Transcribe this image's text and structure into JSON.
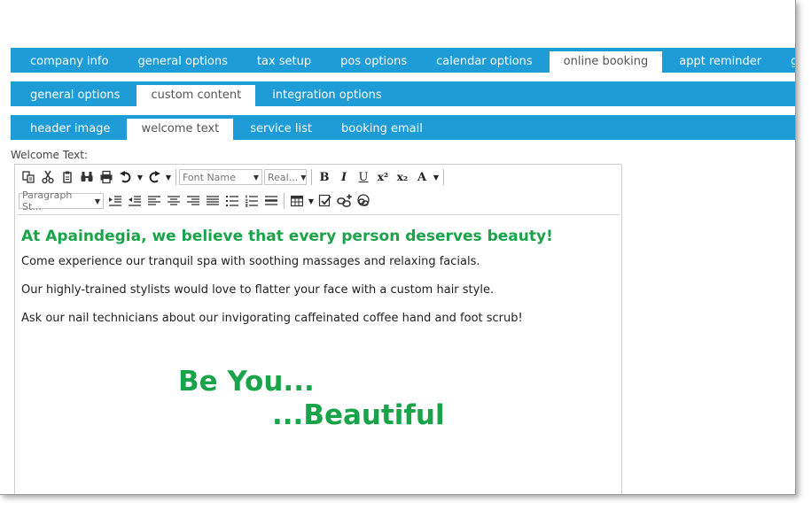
{
  "tabs_main": [
    {
      "label": "company info",
      "active": false
    },
    {
      "label": "general options",
      "active": false
    },
    {
      "label": "tax setup",
      "active": false
    },
    {
      "label": "pos options",
      "active": false
    },
    {
      "label": "calendar options",
      "active": false
    },
    {
      "label": "online booking",
      "active": true
    },
    {
      "label": "appt reminder",
      "active": false
    },
    {
      "label": "goals",
      "active": false
    }
  ],
  "tabs_booking": [
    {
      "label": "general options",
      "active": false
    },
    {
      "label": "custom content",
      "active": true
    },
    {
      "label": "integration options",
      "active": false
    }
  ],
  "tabs_content": [
    {
      "label": "header image",
      "active": false
    },
    {
      "label": "welcome text",
      "active": true
    },
    {
      "label": "service list",
      "active": false
    },
    {
      "label": "booking email",
      "active": false
    }
  ],
  "field_label": "Welcome Text:",
  "toolbar": {
    "font_name": "Font Name",
    "font_size": "Real...",
    "paragraph_style": "Paragraph St...",
    "bold": "B",
    "italic": "I",
    "underline": "U",
    "superscript": "x²",
    "subscript": "x₂",
    "font_color": "A"
  },
  "content": {
    "heading": "At Apaindegia, we believe that every person deserves beauty!",
    "paragraphs": [
      "Come experience our tranquil spa with soothing massages and relaxing facials.",
      "Our highly-trained stylists would love to flatter your face with a custom hair style.",
      "Ask our nail technicians about our invigorating caffeinated coffee hand and foot scrub!"
    ],
    "tagline_1": "Be You...",
    "tagline_2": "...Beautiful"
  },
  "colors": {
    "tab_bar": "#1e9cd7",
    "accent_green": "#1aa44a"
  },
  "icons": [
    "paste-icon",
    "cut-icon",
    "copy-icon",
    "find-icon",
    "print-icon",
    "undo-icon",
    "redo-icon",
    "align-indent-icon",
    "outdent-icon",
    "align-left-icon",
    "align-center-icon",
    "align-right-icon",
    "justify-icon",
    "bullet-list-icon",
    "numbered-list-icon",
    "horizontal-rule-icon",
    "table-icon",
    "spellcheck-icon",
    "insert-link-icon",
    "remove-link-icon"
  ]
}
